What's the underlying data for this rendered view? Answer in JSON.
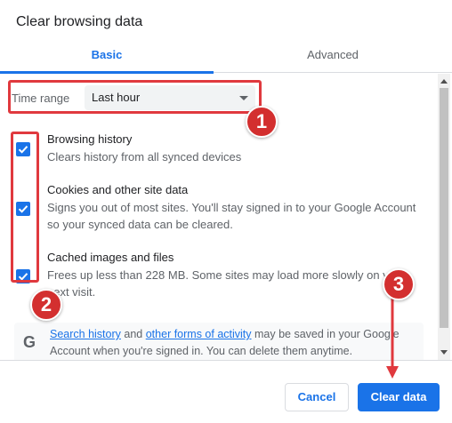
{
  "dialog": {
    "title": "Clear browsing data"
  },
  "tabs": [
    {
      "label": "Basic",
      "active": true
    },
    {
      "label": "Advanced",
      "active": false
    }
  ],
  "time_range": {
    "label": "Time range",
    "value": "Last hour"
  },
  "items": [
    {
      "title": "Browsing history",
      "desc": [
        "Clears history from all synced devices"
      ],
      "checked": true
    },
    {
      "title": "Cookies and other site data",
      "desc": [
        "Signs you out of most sites. You'll stay signed in to your Google Account",
        "so your synced data can be cleared."
      ],
      "checked": true
    },
    {
      "title": "Cached images and files",
      "desc": [
        "Frees up less than 228 MB. Some sites may load more slowly on y",
        "next visit."
      ],
      "checked": true
    }
  ],
  "google_notice": {
    "icon": "G",
    "link1": "Search history",
    "mid": "and",
    "link2": "other forms of activity",
    "line1_rest": "may be saved in your Google",
    "line2": "Account when you're signed in. You can delete them anytime."
  },
  "footer": {
    "cancel_label": "Cancel",
    "clear_label": "Clear data"
  },
  "annotations": {
    "badge1": "1",
    "badge2": "2",
    "badge3": "3",
    "color": "#e0393e"
  },
  "colors": {
    "accent": "#1a73e8",
    "annotation": "#d32f2f"
  }
}
